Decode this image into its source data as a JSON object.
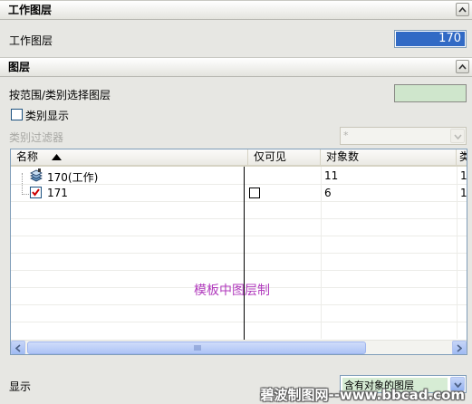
{
  "work_layer_section": {
    "title": "工作图层",
    "field_label": "工作图层",
    "field_value": "170"
  },
  "layer_section": {
    "title": "图层",
    "select_by_range_label": "按范围/类别选择图层",
    "category_display_label": "类别显示",
    "category_filter_label": "类别过滤器",
    "category_filter_value": "*"
  },
  "layer_list": {
    "columns": [
      "名称",
      "仅可见",
      "对象数",
      "类"
    ],
    "rows": [
      {
        "name": "170(工作)",
        "visible_only": "",
        "count": "11",
        "extra": "1"
      },
      {
        "name": "171",
        "visible_only": "",
        "count": "6",
        "extra": "1"
      }
    ],
    "sort_indicator": "ascending"
  },
  "display": {
    "label": "显示",
    "value": "含有对象的图层"
  },
  "overlay_text": "模板中图层制",
  "watermark_text": "碧波制图网--www.bbcad.com",
  "colors": {
    "selection_blue": "#316ac5",
    "category_color": "#cfe6cc",
    "annotation_purple": "#b13bbd",
    "checkmark_red": "#cc0000"
  }
}
